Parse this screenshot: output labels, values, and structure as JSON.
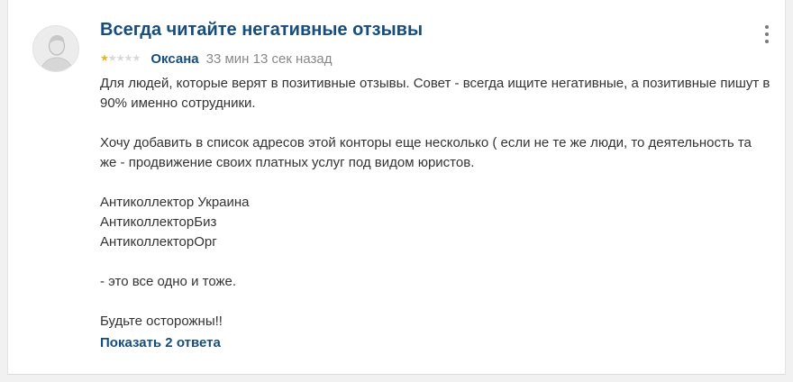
{
  "review": {
    "title": "Всегда читайте негативные отзывы",
    "rating": 1,
    "rating_max": 5,
    "author": "Оксана",
    "time_ago": "33 мин 13 сек назад",
    "avatar_icon": "user-avatar-icon",
    "menu_icon": "more-vertical-icon",
    "paragraphs": [
      "Для людей, которые верят в позитивные отзывы. Совет - всегда ищите негативные, а позитивные пишут в 90% именно сотрудники.",
      "Хочу добавить в список адресов этой конторы еще несколько ( если не те же люди, то деятельность та же - продвижение своих платных услуг под видом юристов.",
      "Антиколлектор Украина",
      "АнтиколлекторБиз",
      "АнтиколлекторОрг",
      "- это все одно и тоже.",
      "Будьте осторожны!!"
    ],
    "show_replies_label": "Показать 2 ответа"
  },
  "colors": {
    "link_blue": "#164d7d",
    "star_on": "#f2b01e",
    "star_off": "#d9d9d9",
    "text": "#333333",
    "muted": "#888888"
  }
}
